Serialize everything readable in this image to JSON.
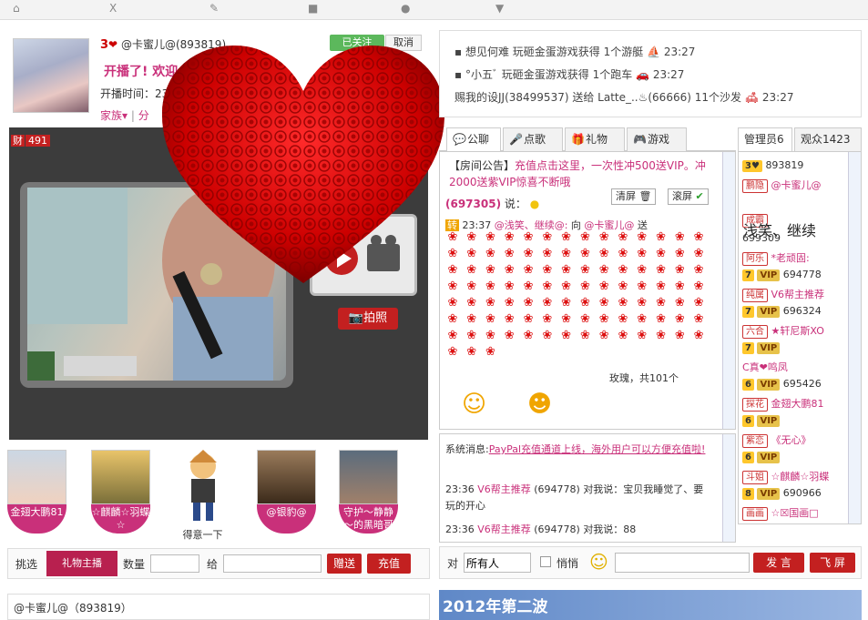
{
  "topbar": {
    "items": [
      "⌂",
      "X",
      "✎",
      "■",
      "●",
      "▼"
    ]
  },
  "host": {
    "level": "3",
    "name": "@卡蜜儿@",
    "id": "(893819)",
    "follow_label": "已关注",
    "cancel_label": "取消",
    "status": "开播了! 欢迎",
    "time_label": "开播时间：23:",
    "family_label": "家族",
    "share_label": "分"
  },
  "video": {
    "wealth_label": "财",
    "wealth_value": "491",
    "photo_label": "拍照"
  },
  "fans": [
    {
      "name": "金翅大鹏81"
    },
    {
      "name": "☆麒麟☆羽蝶☆"
    },
    {
      "name": "得意一下"
    },
    {
      "name": "@银豹@"
    },
    {
      "name": "守护～静静～的黑暗哥"
    }
  ],
  "gift_bar": {
    "pick_label": "挑选",
    "target_label": "礼物主播",
    "qty_label": "数量",
    "to_label": "给",
    "send_label": "赠送",
    "recharge_label": "充值"
  },
  "host_bottom": {
    "text": "@卡蜜儿@（893819）"
  },
  "news": [
    {
      "text": "想见何难  玩砸金蛋游戏获得  1个游艇",
      "time": "23:27"
    },
    {
      "text": "°小五ﾞ 玩砸金蛋游戏获得  1个跑车",
      "time": "23:27"
    },
    {
      "text": "赐我的设JJ(38499537) 送给  Latte_..♨(66666) 11个沙发",
      "time": "23:27"
    }
  ],
  "chat_tabs": [
    "公聊",
    "点歌",
    "礼物",
    "游戏"
  ],
  "user_tabs": [
    "管理员6",
    "观众1423"
  ],
  "chat": {
    "notice_label": "【房间公告】",
    "notice_text": "充值点击这里，一次性冲500送VIP。冲2000送紫VIP惊喜不断哦",
    "sender_id": "(697305)",
    "says": "说：",
    "clear_label": "清屏",
    "scroll_label": "滚屏",
    "forward_label": "转",
    "gift_time": "23:37",
    "gift_from": "@浅笑、继续@:",
    "gift_to_label": "向",
    "gift_to": "@卡蜜儿@",
    "gift_send": "送",
    "gift_summary": "玫瑰，共101个"
  },
  "sys_msgs": {
    "label": "系统消息:",
    "paypal": "PayPal充值通道上线，海外用户可以方便充值啦!",
    "lines": [
      {
        "time": "23:36",
        "user": "V6帮主推荐",
        "id": "(694778)",
        "text": "对我说：宝贝我睡觉了、要玩的开心"
      },
      {
        "time": "23:36",
        "user": "V6帮主推荐",
        "id": "(694778)",
        "text": "对我说：88"
      }
    ]
  },
  "input_bar": {
    "to_label": "对",
    "to_value": "所有人",
    "whisper_label": "悄悄",
    "send_label": "发 言",
    "fly_label": "飞 屏"
  },
  "user_list": [
    {
      "lvl": "3♥",
      "rank": "",
      "name": "893819"
    },
    {
      "lvl": "",
      "rank": "鹏隐",
      "name": "@卡蜜儿@"
    },
    {
      "lvl": "",
      "rank": "",
      "name": ""
    },
    {
      "lvl": "",
      "rank": "成霸",
      "name": ""
    },
    {
      "lvl": "",
      "rank": "",
      "name": "699309"
    },
    {
      "lvl": "",
      "rank": "阿乐",
      "name": "*老顽固:"
    },
    {
      "lvl": "7",
      "rank": "VIP",
      "name": "694778"
    },
    {
      "lvl": "",
      "rank": "纯属",
      "name": "V6帮主推荐"
    },
    {
      "lvl": "7",
      "rank": "VIP",
      "name": "696324"
    },
    {
      "lvl": "",
      "rank": "六合",
      "name": "★轩尼斯XO"
    },
    {
      "lvl": "7",
      "rank": "VIP",
      "name": ""
    },
    {
      "lvl": "",
      "rank": "",
      "name": "C真❤鸣凤"
    },
    {
      "lvl": "6",
      "rank": "VIP",
      "name": "695426"
    },
    {
      "lvl": "",
      "rank": "探花",
      "name": "金翅大鹏81"
    },
    {
      "lvl": "6",
      "rank": "VIP",
      "name": ""
    },
    {
      "lvl": "",
      "rank": "紫恋",
      "name": "《无心》"
    },
    {
      "lvl": "6",
      "rank": "VIP",
      "name": ""
    },
    {
      "lvl": "",
      "rank": "斗姐",
      "name": "☆麒麟☆羽蝶"
    },
    {
      "lvl": "8",
      "rank": "VIP",
      "name": "690966"
    },
    {
      "lvl": "",
      "rank": "画画",
      "name": "☆☒国画□"
    }
  ],
  "watermark": {
    "text": "浅笑、继续"
  },
  "banner": {
    "text": "2012年第二波"
  }
}
